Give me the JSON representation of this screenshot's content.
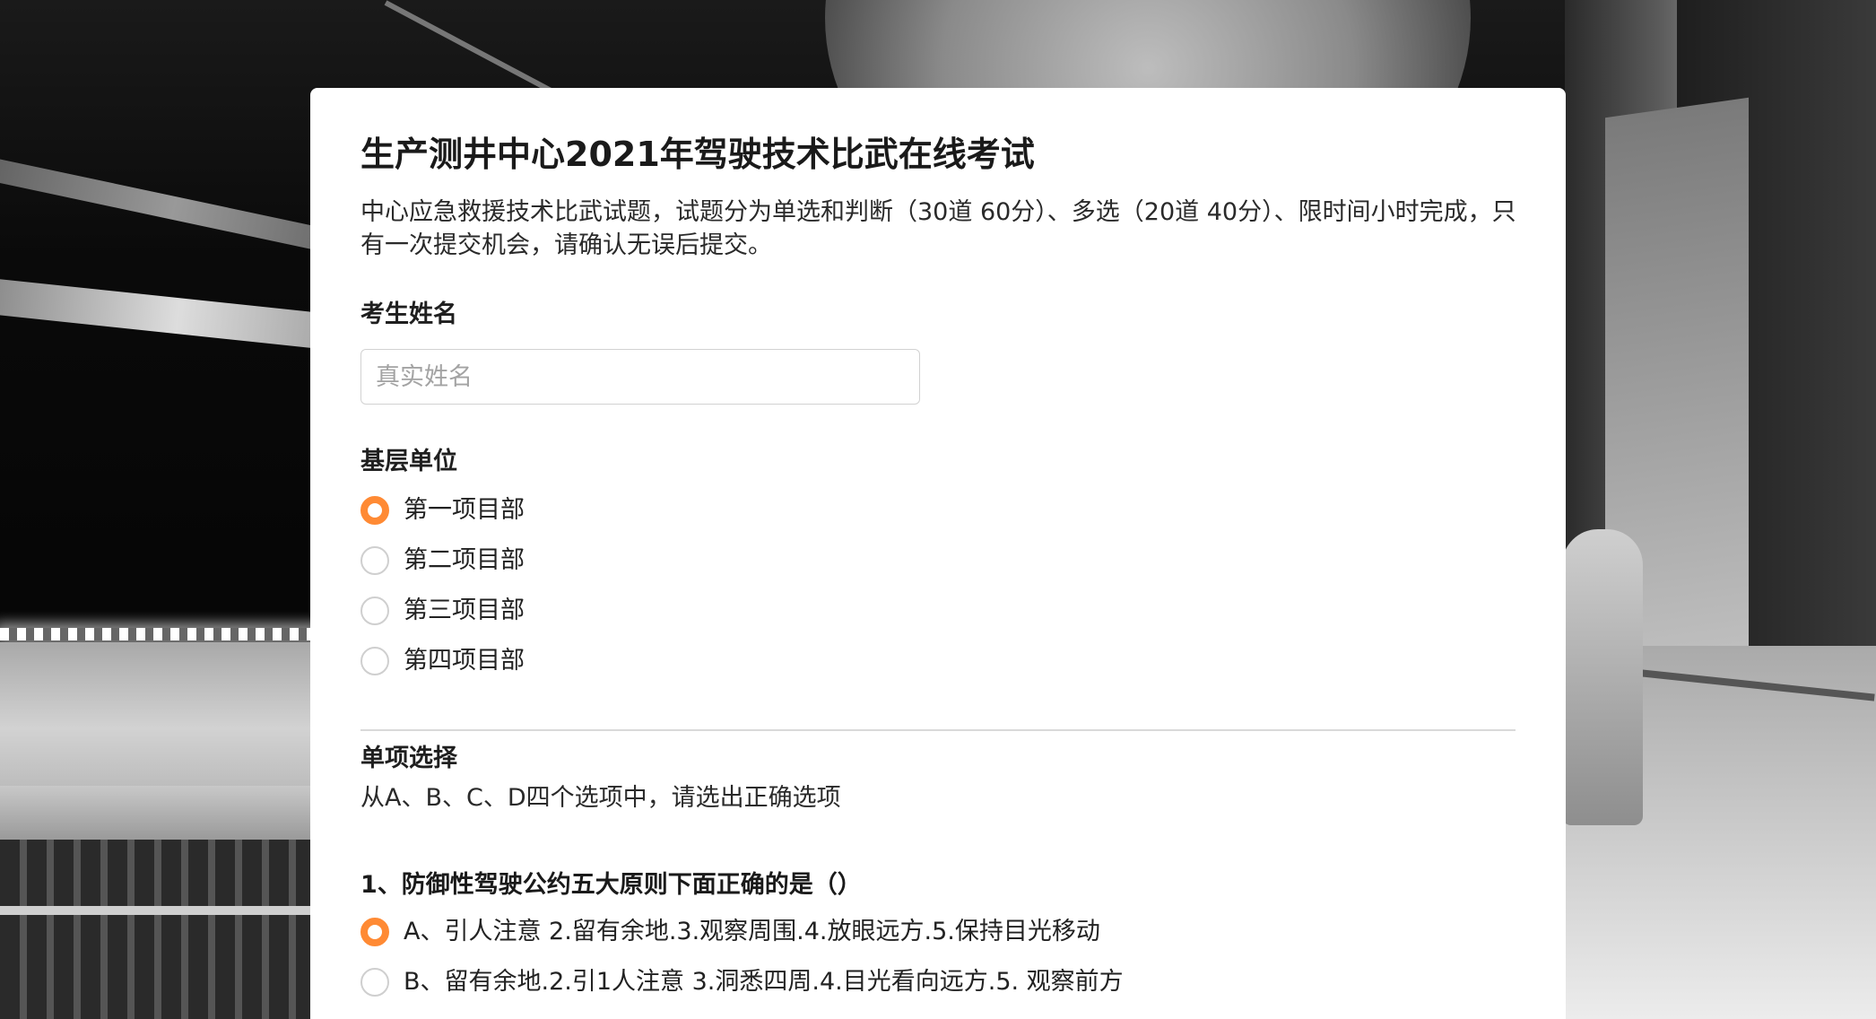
{
  "form": {
    "title": "生产测井中心2021年驾驶技术比武在线考试",
    "description": "中心应急救援技术比武试题，试题分为单选和判断（30道 60分）、多选（20道 40分）、限时间小时完成，只有一次提交机会，请确认无误后提交。",
    "name_field": {
      "label": "考生姓名",
      "placeholder": "真实姓名",
      "value": ""
    },
    "unit_field": {
      "label": "基层单位",
      "options": [
        {
          "label": "第一项目部",
          "checked": true
        },
        {
          "label": "第二项目部",
          "checked": false
        },
        {
          "label": "第三项目部",
          "checked": false
        },
        {
          "label": "第四项目部",
          "checked": false
        }
      ]
    },
    "section": {
      "title": "单项选择",
      "description": "从A、B、C、D四个选项中，请选出正确选项"
    },
    "question_1": {
      "text": "1、防御性驾驶公约五大原则下面正确的是（）",
      "options": [
        {
          "label": "A、引人注意 2.留有余地.3.观察周围.4.放眼远方.5.保持目光移动",
          "checked": true
        },
        {
          "label": "B、留有余地.2.引1人注意 3.洞悉四周.4.目光看向远方.5. 观察前方",
          "checked": false
        }
      ]
    }
  },
  "colors": {
    "accent": "#ff8a34",
    "card_background": "#ffffff",
    "border": "#d2d2d2"
  }
}
